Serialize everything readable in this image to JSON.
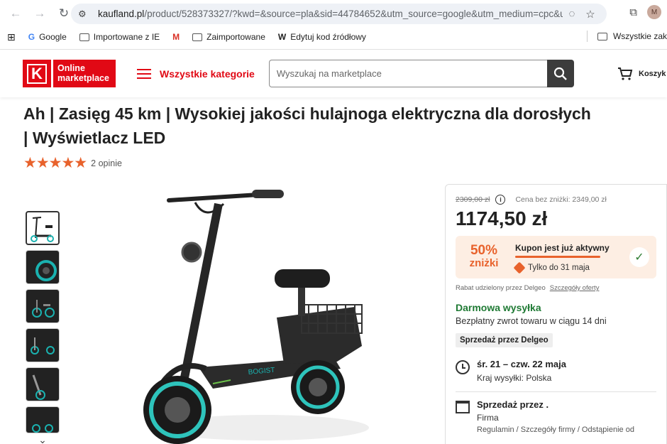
{
  "browser": {
    "url_host": "kaufland.pl",
    "url_rest": "/product/528373327/?kwd=&source=pla&sid=44784652&utm_source=google&utm_medium=cpc&u...",
    "profile_initial": "M"
  },
  "bookmarks": {
    "items": [
      "Google",
      "Importowane z IE",
      "Zaimportowane",
      "Edytuj kod źródłowy"
    ],
    "right": "Wszystkie zak"
  },
  "header": {
    "logo_text": "Online marketplace",
    "categories_label": "Wszystkie kategorie",
    "search_placeholder": "Wyszukaj na marketplace",
    "cart_label": "Koszyk"
  },
  "product": {
    "title_line1": "Ah | Zasięg 45 km | Wysokiej jakości hulajnoga elektryczna dla dorosłych",
    "title_line2": "| Wyświetlacz LED",
    "stars": "★★★★★",
    "reviews": "2 opinie"
  },
  "pricebox": {
    "old_price": "2309,00 zł",
    "info": "i",
    "ref_price": "Cena bez zniżki: 2349,00 zł",
    "price": "1174,50 zł",
    "discount_pct": "50%",
    "discount_word": "zniżki",
    "coupon_title": "Kupon jest już aktywny",
    "coupon_until": "Tylko do 31 maja",
    "check": "✓",
    "rebate_text": "Rabat udzielony przez Delgeo",
    "rebate_link": "Szczegóły oferty",
    "free_shipping": "Darmowa wysyłka",
    "free_return": "Bezpłatny zwrot towaru w ciągu 14 dni",
    "seller_badge": "Sprzedaż przez Delgeo",
    "delivery_dates": "śr. 21 – czw. 22 maja",
    "delivery_country": "Kraj wysyłki: Polska",
    "seller_title": "Sprzedaż przez .",
    "seller_sub": "Firma",
    "seller_links": "Regulamin / Szczegóły firmy / Odstąpienie od"
  }
}
